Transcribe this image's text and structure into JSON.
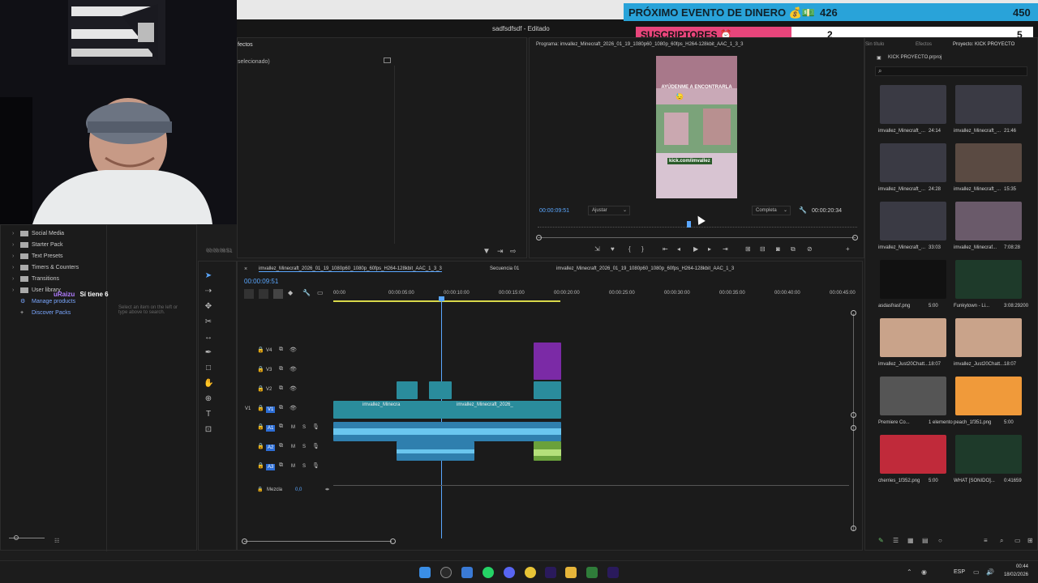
{
  "overlay": {
    "event_label": "PRÓXIMO EVENTO DE DINERO 💰💵",
    "event_current": "426",
    "event_goal": "450",
    "subs_label": "SUSCRIPTORES ⏰",
    "subs_current": "2",
    "subs_goal": "5"
  },
  "window": {
    "title": "sadfsdfsdf - Editado"
  },
  "effects_panel": {
    "title": "fectos",
    "subtitle": "selecionado)"
  },
  "left_library": {
    "items": [
      "Social Media",
      "Starter Pack",
      "Text Presets",
      "Timers & Counters",
      "Transitions",
      "User library"
    ],
    "manage": "Manage products",
    "discover": "Discover Packs",
    "hint": "Select an item on the left or type above to search.",
    "time": "00:00:09:51"
  },
  "chat": {
    "user": "uRaizu",
    "message": "Sí tiene 6"
  },
  "program": {
    "title": "Programa: imvallez_Minecraft_2026_01_19_1080p60_1080p_60fps_H264-128kbit_AAC_1_3_3",
    "timecode": "00:00:09:51",
    "fit": "Ajustar",
    "quality": "Completa",
    "duration": "00:00:20:34",
    "video_text_top": "AYÚDENME A ENCONTRARLA",
    "video_text_link": "kick.com/imvallez"
  },
  "timeline": {
    "tabs": [
      "imvallez_Minecraft_2026_01_19_1080p60_1080p_60fps_H264-128kbit_AAC_1_3_3",
      "Secuencia 01",
      "imvallez_Minecraft_2026_01_19_1080p60_1080p_60fps_H264-128kbit_AAC_1_3"
    ],
    "timecode": "00:00:09:51",
    "ruler": [
      "00:00",
      "00:00:05:00",
      "00:00:10:00",
      "00:00:15:00",
      "00:00:20:00",
      "00:00:25:00",
      "00:00:30:00",
      "00:00:35:00",
      "00:00:40:00",
      "00:00:45:00"
    ],
    "video_tracks": [
      "V4",
      "V3",
      "V2",
      "V1"
    ],
    "audio_tracks": [
      "A1",
      "A2",
      "A3"
    ],
    "mix_label": "Mezcla",
    "mix_value": "0,0",
    "clip1": "imvallez_Minecra",
    "clip2": "imvallez_Minecraft_2026_"
  },
  "project": {
    "tabs": [
      "Sin título",
      "Efectos",
      "Proyecto: KICK PROYECTO"
    ],
    "path": "KICK PROYECTO.prproj",
    "items": [
      {
        "name": "imvallez_Minecraft_...",
        "dur": "24:14"
      },
      {
        "name": "imvallez_Minecraft_...",
        "dur": "21:46"
      },
      {
        "name": "imvallez_Minecraft_...",
        "dur": "24:28"
      },
      {
        "name": "imvallez_Minecraft_...",
        "dur": "15:35"
      },
      {
        "name": "imvallez_Minecraft_...",
        "dur": "33:03"
      },
      {
        "name": "imvallez_Minecraf...",
        "dur": "7:08:28"
      },
      {
        "name": "asdasfrasf.png",
        "dur": "5:00"
      },
      {
        "name": "Funkytown - Li...",
        "dur": "3:08:29200"
      },
      {
        "name": "imvallez_Just20Chatt...",
        "dur": "18:07"
      },
      {
        "name": "imvallez_Just20Chatt...",
        "dur": "18:07"
      },
      {
        "name": "Premiere Co...",
        "dur": "1 elemento"
      },
      {
        "name": "peach_1f351.png",
        "dur": "5:00"
      },
      {
        "name": "cherries_1f352.png",
        "dur": "5:00"
      },
      {
        "name": "WHAT [SONIDO]...",
        "dur": "0:41659"
      }
    ]
  },
  "taskbar": {
    "lang": "ESP",
    "time": "00:44",
    "date": "18/02/2026"
  },
  "colors": {
    "accent": "#2d8ceb",
    "overlay_blue": "#29a3d9",
    "overlay_pink": "#e8457b",
    "clip_teal": "#2a8c9c",
    "clip_purple": "#7b2aa6",
    "audio_blue": "#3ba7d6",
    "playhead": "#5aa7ff"
  }
}
